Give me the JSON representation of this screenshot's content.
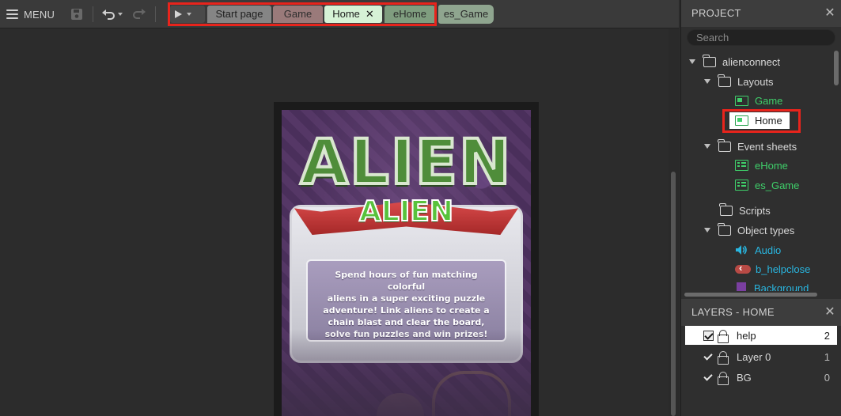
{
  "toolbar": {
    "menu_label": "MENU",
    "tabs": [
      {
        "label": "Start page"
      },
      {
        "label": "Game"
      },
      {
        "label": "Home",
        "close": "✕"
      },
      {
        "label": "eHome"
      },
      {
        "label": "es_Game"
      }
    ]
  },
  "game_preview": {
    "logo_big": "ALIEN",
    "logo_small": "ALIEN",
    "description": "Spend hours of fun matching colorful\naliens in a super exciting puzzle\nadventure! Link aliens to create a\nchain blast and clear the board,\nsolve fun  puzzles and win prizes!"
  },
  "project": {
    "title": "PROJECT",
    "close": "✕",
    "search_placeholder": "Search",
    "root": "alienconnect",
    "layouts_folder": "Layouts",
    "layouts": [
      "Game",
      "Home"
    ],
    "event_folder": "Event sheets",
    "event_sheets": [
      "eHome",
      "es_Game"
    ],
    "scripts_folder": "Scripts",
    "object_types_folder": "Object types",
    "object_types": [
      {
        "name": "Audio",
        "icon": "speaker-icon"
      },
      {
        "name": "b_helpclose",
        "icon": "button-icon"
      },
      {
        "name": "Background",
        "icon": "sprite-icon"
      }
    ]
  },
  "layers": {
    "title": "LAYERS - HOME",
    "close": "✕",
    "items": [
      {
        "name": "help",
        "index": "2",
        "selected": true
      },
      {
        "name": "Layer 0",
        "index": "1",
        "selected": false
      },
      {
        "name": "BG",
        "index": "0",
        "selected": false
      }
    ]
  },
  "colors": {
    "highlight": "#e8241c",
    "layout_text": "#3fcf6a",
    "object_text": "#29b6e0"
  }
}
